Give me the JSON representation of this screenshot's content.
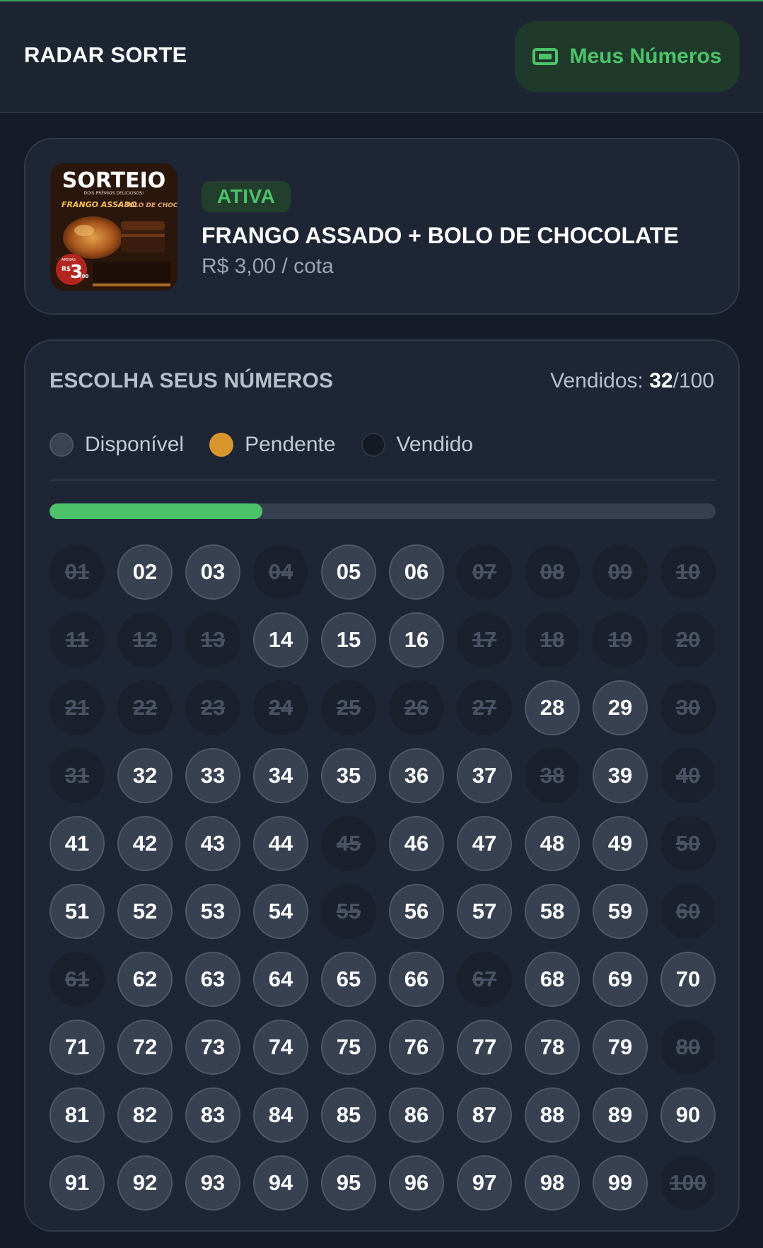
{
  "header": {
    "brand": "RADAR SORTE",
    "my_numbers_label": "Meus Números",
    "my_numbers_icon": "ticket-icon"
  },
  "raffle": {
    "status": "ATIVA",
    "title": "FRANGO ASSADO + BOLO DE CHOCOLATE",
    "price": "R$ 3,00 / cota",
    "image_text": {
      "headline": "SORTEIO",
      "tagline": "DOIS PRÊMIOS DELICIOSOS!",
      "item1": "FRANGO ASSADO",
      "item2": "+ BOLO DE CHOCOLATE",
      "price_prefix": "APENAS",
      "currency": "R$",
      "price_int": "3",
      "price_cents": ",00"
    }
  },
  "picker": {
    "title": "ESCOLHA SEUS NÚMEROS",
    "sold_label": "Vendidos: ",
    "sold": "32",
    "total": "/100",
    "progress_fraction": 0.32,
    "legend": {
      "available": "Disponível",
      "pending": "Pendente",
      "sold": "Vendido"
    },
    "colors": {
      "available": "#384151",
      "pending": "#d8952e",
      "sold": "#1a212d",
      "accent": "#4cc36a"
    },
    "sold_numbers": [
      1,
      4,
      7,
      8,
      9,
      10,
      11,
      12,
      13,
      17,
      18,
      19,
      20,
      21,
      22,
      23,
      24,
      25,
      26,
      27,
      30,
      31,
      38,
      40,
      45,
      50,
      55,
      60,
      61,
      67,
      80,
      100
    ],
    "numbers": [
      "01",
      "02",
      "03",
      "04",
      "05",
      "06",
      "07",
      "08",
      "09",
      "10",
      "11",
      "12",
      "13",
      "14",
      "15",
      "16",
      "17",
      "18",
      "19",
      "20",
      "21",
      "22",
      "23",
      "24",
      "25",
      "26",
      "27",
      "28",
      "29",
      "30",
      "31",
      "32",
      "33",
      "34",
      "35",
      "36",
      "37",
      "38",
      "39",
      "40",
      "41",
      "42",
      "43",
      "44",
      "45",
      "46",
      "47",
      "48",
      "49",
      "50",
      "51",
      "52",
      "53",
      "54",
      "55",
      "56",
      "57",
      "58",
      "59",
      "60",
      "61",
      "62",
      "63",
      "64",
      "65",
      "66",
      "67",
      "68",
      "69",
      "70",
      "71",
      "72",
      "73",
      "74",
      "75",
      "76",
      "77",
      "78",
      "79",
      "80",
      "81",
      "82",
      "83",
      "84",
      "85",
      "86",
      "87",
      "88",
      "89",
      "90",
      "91",
      "92",
      "93",
      "94",
      "95",
      "96",
      "97",
      "98",
      "99",
      "100"
    ]
  }
}
